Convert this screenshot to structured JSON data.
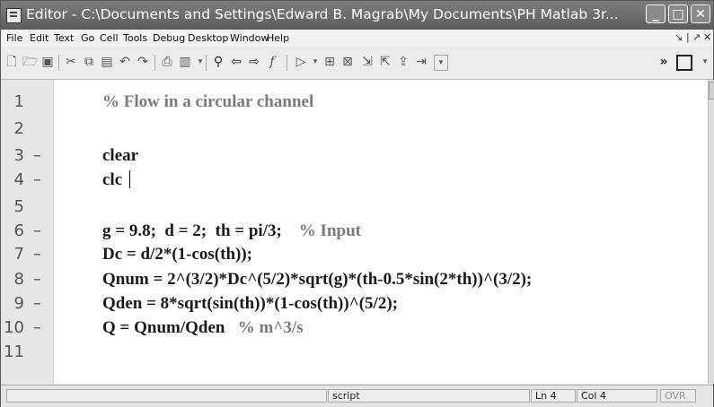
{
  "window": {
    "title": "Editor - C:\\Documents and Settings\\Edward B. Magrab\\My Documents\\PH Matlab 3r..."
  },
  "title_buttons": [
    {
      "name": "minimize-button",
      "glyph": "_"
    },
    {
      "name": "maximize-button",
      "glyph": "□"
    },
    {
      "name": "close-button",
      "glyph": "✕"
    }
  ],
  "menu": {
    "items": [
      "File",
      "Edit",
      "Text",
      "Go",
      "Cell",
      "Tools",
      "Debug",
      "Desktop",
      "Window",
      "Help"
    ],
    "dock_glyphs": [
      "↘",
      "|",
      "↗",
      "✕"
    ]
  },
  "toolbar": {
    "icons": [
      "new-file-icon",
      "open-folder-icon",
      "save-icon",
      "cut-icon",
      "copy-icon",
      "paste-icon",
      "undo-icon",
      "redo-icon",
      "print-icon",
      "print-preview-icon",
      "find-icon",
      "back-arrow-icon",
      "forward-arrow-icon",
      "function-icon",
      "run-icon",
      "breakpoint-set-icon",
      "breakpoint-clear-icon",
      "step-icon",
      "step-in-icon",
      "step-out-icon",
      "continue-icon",
      "stack-dropdown-icon",
      "overflow-chevron-icon",
      "window-toggle-icon"
    ]
  },
  "code": {
    "lines": [
      {
        "num": "1",
        "dash": "",
        "text": "% Flow in a circular channel",
        "comment": ""
      },
      {
        "num": "2",
        "dash": "",
        "text": "",
        "comment": ""
      },
      {
        "num": "3",
        "dash": "–",
        "text": "clear",
        "comment": ""
      },
      {
        "num": "4",
        "dash": "–",
        "text": "clc",
        "comment": ""
      },
      {
        "num": "5",
        "dash": "",
        "text": "",
        "comment": ""
      },
      {
        "num": "6",
        "dash": "–",
        "text": "g = 9.8;  d = 2;  th = pi/3;    ",
        "comment": "% Input"
      },
      {
        "num": "7",
        "dash": "–",
        "text": "Dc = d/2*(1-cos(th));",
        "comment": ""
      },
      {
        "num": "8",
        "dash": "–",
        "text": "Qnum = 2^(3/2)*Dc^(5/2)*sqrt(g)*(th-0.5*sin(2*th))^(3/2);",
        "comment": ""
      },
      {
        "num": "9",
        "dash": "–",
        "text": "Qden = 8*sqrt(sin(th))*(1-cos(th))^(5/2);",
        "comment": ""
      },
      {
        "num": "10",
        "dash": "–",
        "text": "Q = Qnum/Qden   ",
        "comment": "% m^3/s"
      },
      {
        "num": "11",
        "dash": "",
        "text": "",
        "comment": ""
      }
    ]
  },
  "status": {
    "mode": "script",
    "ln_label": "Ln",
    "ln_value": "4",
    "col_label": "Col",
    "col_value": "4",
    "ovr": "OVR"
  }
}
